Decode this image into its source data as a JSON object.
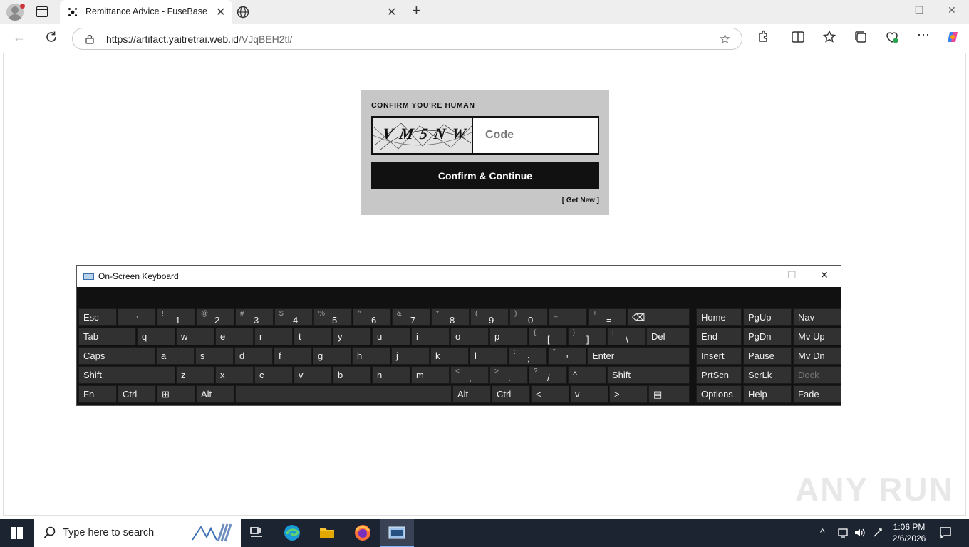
{
  "browser": {
    "tabs": [
      {
        "title": "Remittance Advice - FuseBase",
        "close": "✕"
      },
      {
        "title": "",
        "close": "✕"
      }
    ],
    "new_tab": "+",
    "window_controls": {
      "minimize": "—",
      "restore": "❐",
      "close": "✕"
    },
    "url_host": "https://artifact.yaitretrai.web.id",
    "url_path": "/VJqBEH2tl/"
  },
  "captcha": {
    "title": "CONFIRM YOU'RE HUMAN",
    "image_text": "VM5NW",
    "input_placeholder": "Code",
    "button": "Confirm & Continue",
    "get_new": "[ Get New ]"
  },
  "osk": {
    "title": "On-Screen Keyboard",
    "controls": {
      "minimize": "—",
      "maximize": "☐",
      "close": "✕"
    },
    "rows": [
      [
        {
          "m": "Esc"
        },
        {
          "s": "~",
          "l": "`"
        },
        {
          "s": "!",
          "l": "1"
        },
        {
          "s": "@",
          "l": "2"
        },
        {
          "s": "#",
          "l": "3"
        },
        {
          "s": "$",
          "l": "4"
        },
        {
          "s": "%",
          "l": "5"
        },
        {
          "s": "^",
          "l": "6"
        },
        {
          "s": "&",
          "l": "7"
        },
        {
          "s": "*",
          "l": "8"
        },
        {
          "s": "(",
          "l": "9"
        },
        {
          "s": ")",
          "l": "0"
        },
        {
          "s": "_",
          "l": "-"
        },
        {
          "s": "+",
          "l": "="
        },
        {
          "m": "⌫"
        },
        {
          "m": "Home"
        },
        {
          "m": "PgUp"
        },
        {
          "m": "Nav"
        }
      ],
      [
        {
          "m": "Tab"
        },
        {
          "m": "q"
        },
        {
          "m": "w"
        },
        {
          "m": "e"
        },
        {
          "m": "r"
        },
        {
          "m": "t"
        },
        {
          "m": "y"
        },
        {
          "m": "u"
        },
        {
          "m": "i"
        },
        {
          "m": "o"
        },
        {
          "m": "p"
        },
        {
          "s": "{",
          "l": "["
        },
        {
          "s": "}",
          "l": "]"
        },
        {
          "s": "|",
          "l": "\\"
        },
        {
          "m": "Del"
        },
        {
          "m": "End"
        },
        {
          "m": "PgDn"
        },
        {
          "m": "Mv Up"
        }
      ],
      [
        {
          "m": "Caps"
        },
        {
          "m": "a"
        },
        {
          "m": "s"
        },
        {
          "m": "d"
        },
        {
          "m": "f"
        },
        {
          "m": "g"
        },
        {
          "m": "h"
        },
        {
          "m": "j"
        },
        {
          "m": "k"
        },
        {
          "m": "l"
        },
        {
          "s": ":",
          "l": ";"
        },
        {
          "s": "\"",
          "l": "'"
        },
        {
          "m": "Enter"
        },
        {
          "m": "Insert"
        },
        {
          "m": "Pause"
        },
        {
          "m": "Mv Dn"
        }
      ],
      [
        {
          "m": "Shift"
        },
        {
          "m": "z"
        },
        {
          "m": "x"
        },
        {
          "m": "c"
        },
        {
          "m": "v"
        },
        {
          "m": "b"
        },
        {
          "m": "n"
        },
        {
          "m": "m"
        },
        {
          "s": "<",
          "l": ","
        },
        {
          "s": ">",
          "l": "."
        },
        {
          "s": "?",
          "l": "/"
        },
        {
          "m": "^"
        },
        {
          "m": "Shift"
        },
        {
          "m": "PrtScn"
        },
        {
          "m": "ScrLk"
        },
        {
          "m": "Dock",
          "dim": true
        }
      ],
      [
        {
          "m": "Fn"
        },
        {
          "m": "Ctrl"
        },
        {
          "m": "⊞"
        },
        {
          "m": "Alt"
        },
        {
          "m": ""
        },
        {
          "m": "Alt"
        },
        {
          "m": "Ctrl"
        },
        {
          "m": "<"
        },
        {
          "m": "v"
        },
        {
          "m": ">"
        },
        {
          "m": "▤"
        },
        {
          "m": "Options"
        },
        {
          "m": "Help"
        },
        {
          "m": "Fade"
        }
      ]
    ]
  },
  "watermark": "ANY RUN",
  "taskbar": {
    "search_placeholder": "Type here to search",
    "time": "1:06 PM",
    "date": "2/6/2026"
  },
  "colors": {
    "captcha_bg": "#c7c7c7",
    "button_bg": "#111111",
    "taskbar_bg": "#1c2331",
    "osk_key": "#313131"
  }
}
